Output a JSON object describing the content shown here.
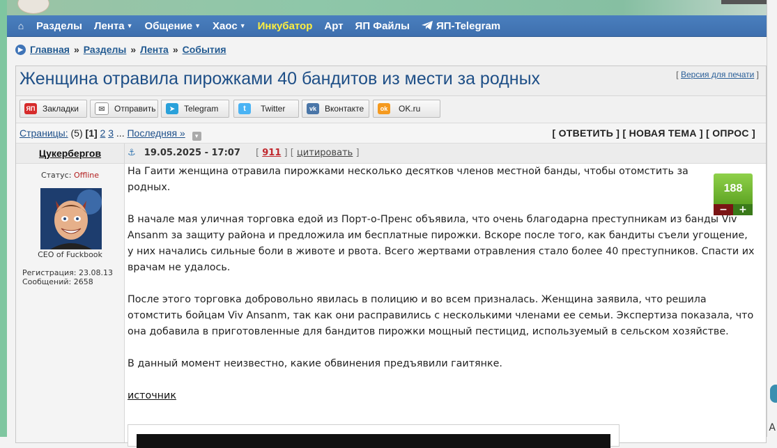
{
  "nav": {
    "items": [
      {
        "label": "Разделы",
        "caret": false,
        "highlight": false
      },
      {
        "label": "Лента",
        "caret": true,
        "highlight": false
      },
      {
        "label": "Общение",
        "caret": true,
        "highlight": false
      },
      {
        "label": "Хаос",
        "caret": true,
        "highlight": false
      },
      {
        "label": "Инкубатор",
        "caret": false,
        "highlight": true
      },
      {
        "label": "Арт",
        "caret": false,
        "highlight": false
      },
      {
        "label": "ЯП Файлы",
        "caret": false,
        "highlight": false
      },
      {
        "label": "ЯП-Telegram",
        "caret": false,
        "highlight": false
      }
    ],
    "highlight_color": "#ffef3f"
  },
  "breadcrumbs": [
    "Главная",
    "Разделы",
    "Лента",
    "События"
  ],
  "topic": {
    "title": "Женщина отравила пирожками 40 бандитов из мести за родных",
    "print_label": "Версия для печати"
  },
  "share": [
    {
      "label": "Закладки",
      "icon": "yap-icon",
      "color": "#d62b2b",
      "glyph": "ЯП"
    },
    {
      "label": "Отправить",
      "icon": "mail-icon",
      "color": "#8a8a8a",
      "glyph": "✉"
    },
    {
      "label": "Telegram",
      "icon": "telegram-icon",
      "color": "#2aa1da",
      "glyph": "➤"
    },
    {
      "label": "Twitter",
      "icon": "twitter-icon",
      "color": "#4ab3f4",
      "glyph": "t"
    },
    {
      "label": "Вконтакте",
      "icon": "vk-icon",
      "color": "#4a76a8",
      "glyph": "vk"
    },
    {
      "label": "OK.ru",
      "icon": "ok-icon",
      "color": "#f59a1f",
      "glyph": "ok"
    }
  ],
  "pager": {
    "label": "Страницы:",
    "total": "(5)",
    "current": "[1]",
    "pages": [
      "2",
      "3"
    ],
    "ellipsis": "...",
    "last": "Последняя »"
  },
  "actions": "[ ОТВЕТИТЬ ] [ НОВАЯ ТЕМА ] [ ОПРОС ]",
  "post": {
    "author": "Цукербергов",
    "date": "19.05.2025 - 17:07",
    "number": "911",
    "quote": "цитировать",
    "status_label": "Статус:",
    "status_value": "Offline",
    "role": "CEO of Fuckbook",
    "registration": "Регистрация: 23.08.13",
    "messages": "Сообщений: 2658",
    "rating": "188",
    "paragraphs": [
      "На Гаити женщина отравила пирожками несколько десятков членов местной банды, чтобы отомстить за родных.",
      "В начале мая уличная торговка едой из Порт-о-Пренс объявила, что очень благодарна преступникам из банды Viv Ansanm за защиту района и предложила им бесплатные пирожки. Вскоре после того, как бандиты съели угощение, у них начались сильные боли в животе и рвота. Всего жертвами отравления стало более 40 преступников. Спасти их врачам не удалось.",
      "После этого торговка добровольно явилась в полицию и во всем призналась. Женщина заявила, что решила отомстить бойцам Viv Ansanm, так как они расправились с несколькими членами ее семьи. Экспертиза показала, что она добавила в приготовленные для бандитов пирожки мощный пестицид, используемый в сельском хозяйстве.",
      "В данный момент неизвестно, какие обвинения предъявили гаитянке."
    ],
    "source_link": "источник"
  }
}
